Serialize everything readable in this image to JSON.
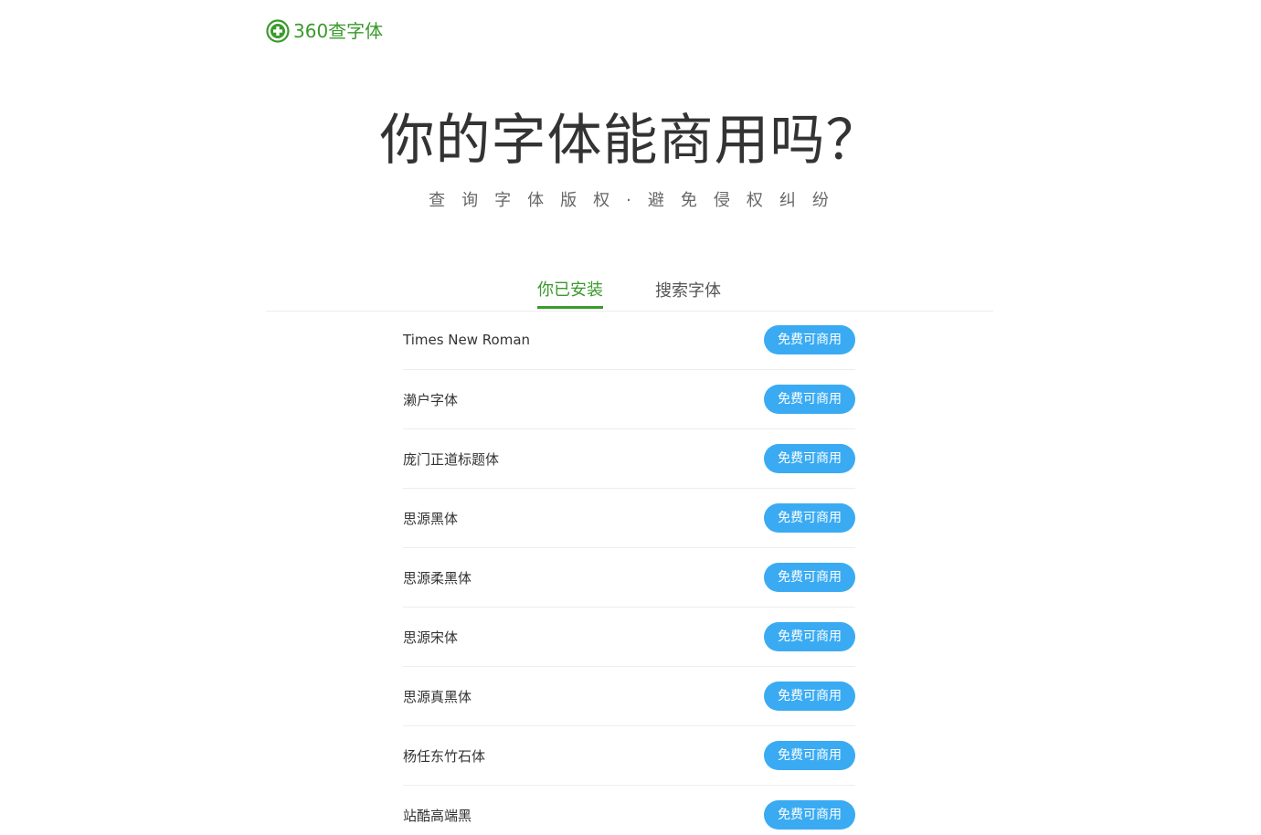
{
  "header": {
    "logo_text": "360查字体",
    "brand_color": "#3a9a2c",
    "logo_icon": "plus-circle-icon"
  },
  "hero": {
    "title": "你的字体能商用吗？",
    "subtitle": "查询字体版权·避免侵权纠纷"
  },
  "tabs": [
    {
      "label": "你已安装",
      "active": true
    },
    {
      "label": "搜索字体",
      "active": false
    }
  ],
  "badge_color": "#3aabf2",
  "fonts": [
    {
      "name": "Times New Roman",
      "status": "免费可商用"
    },
    {
      "name": "濑户字体",
      "status": "免费可商用"
    },
    {
      "name": "庞门正道标题体",
      "status": "免费可商用"
    },
    {
      "name": "思源黑体",
      "status": "免费可商用"
    },
    {
      "name": "思源柔黑体",
      "status": "免费可商用"
    },
    {
      "name": "思源宋体",
      "status": "免费可商用"
    },
    {
      "name": "思源真黑体",
      "status": "免费可商用"
    },
    {
      "name": "杨任东竹石体",
      "status": "免费可商用"
    },
    {
      "name": "站酷高端黑",
      "status": "免费可商用"
    }
  ]
}
